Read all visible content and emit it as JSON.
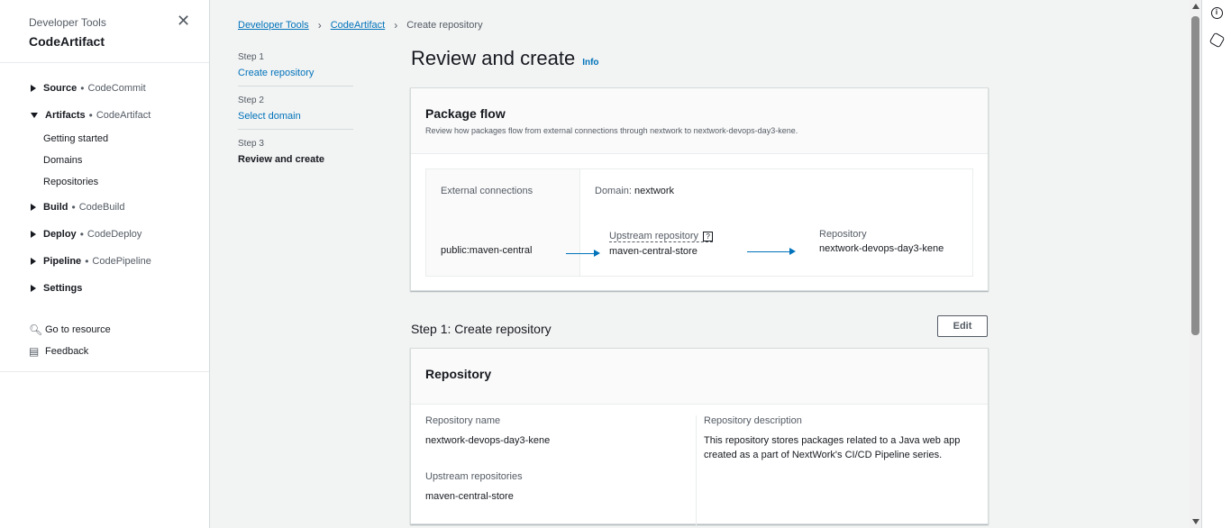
{
  "sidebar": {
    "subtitle": "Developer Tools",
    "title": "CodeArtifact",
    "groups": [
      {
        "label": "Source",
        "sub": "CodeCommit"
      },
      {
        "label": "Artifacts",
        "sub": "CodeArtifact"
      },
      {
        "label": "Build",
        "sub": "CodeBuild"
      },
      {
        "label": "Deploy",
        "sub": "CodeDeploy"
      },
      {
        "label": "Pipeline",
        "sub": "CodePipeline"
      },
      {
        "label": "Settings"
      }
    ],
    "artifact_items": [
      "Getting started",
      "Domains",
      "Repositories"
    ],
    "links": [
      "Go to resource",
      "Feedback"
    ]
  },
  "breadcrumb": [
    "Developer Tools",
    "CodeArtifact",
    "Create repository"
  ],
  "steps": [
    {
      "num": "Step 1",
      "label": "Create repository"
    },
    {
      "num": "Step 2",
      "label": "Select domain"
    },
    {
      "num": "Step 3",
      "label": "Review and create"
    }
  ],
  "page": {
    "title": "Review and create",
    "info": "Info"
  },
  "package_flow": {
    "title": "Package flow",
    "description": "Review how packages flow from external connections through nextwork to nextwork-devops-day3-kene.",
    "external_label": "External connections",
    "external_value": "public:maven-central",
    "domain_label": "Domain:",
    "domain_value": "nextwork",
    "upstream_label": "Upstream repository",
    "upstream_value": "maven-central-store",
    "repo_label": "Repository",
    "repo_value": "nextwork-devops-day3-kene"
  },
  "step1": {
    "title": "Step 1: Create repository",
    "edit": "Edit",
    "card_title": "Repository",
    "name_label": "Repository name",
    "name_value": "nextwork-devops-day3-kene",
    "upstream_label": "Upstream repositories",
    "upstream_value": "maven-central-store",
    "desc_label": "Repository description",
    "desc_value": "This repository stores packages related to a Java web app created as a part of NextWork's CI/CD Pipeline series."
  }
}
